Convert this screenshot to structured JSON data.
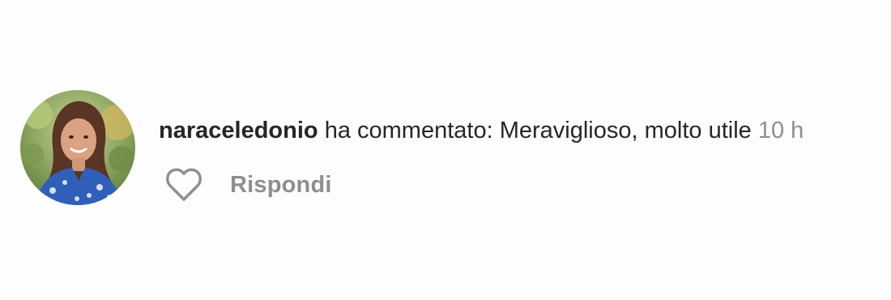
{
  "notification": {
    "username": "naraceledonio",
    "action_text": "ha commentato:",
    "comment": "Meraviglioso, molto utile",
    "time": "10 h",
    "reply_label": "Rispondi",
    "like_icon": "heart-outline-icon",
    "colors": {
      "primary_text": "#262626",
      "secondary_text": "#8e8e8e"
    }
  }
}
